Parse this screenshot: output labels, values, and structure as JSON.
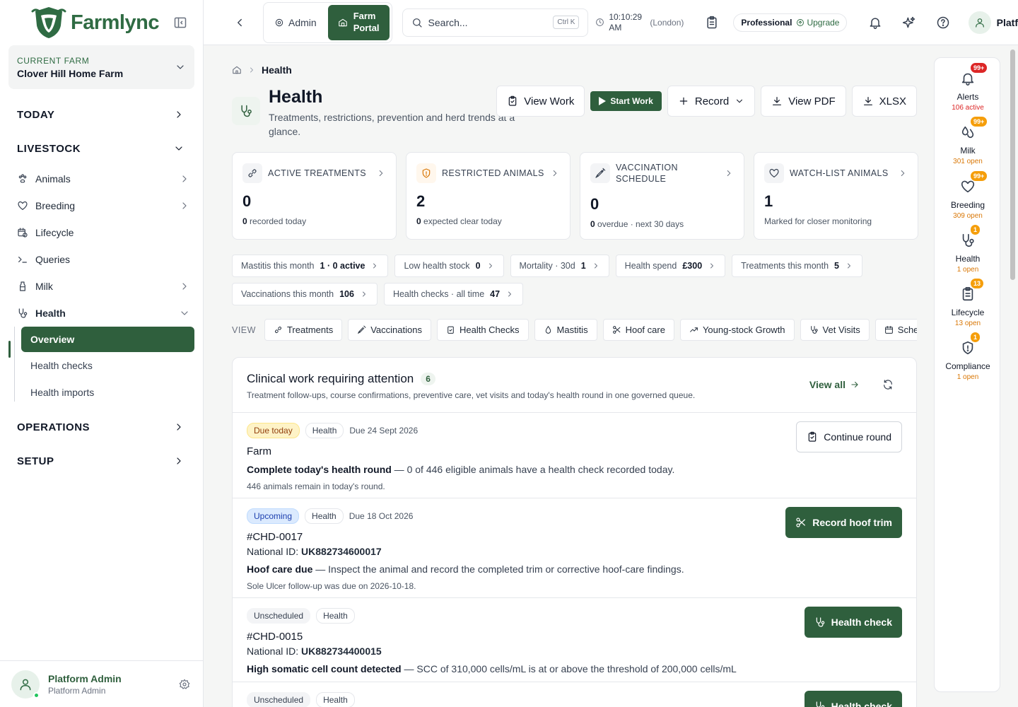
{
  "brand": {
    "name": "Farmlync"
  },
  "farm": {
    "label": "CURRENT FARM",
    "name": "Clover Hill Home Farm"
  },
  "nav": {
    "today": "TODAY",
    "livestock": "LIVESTOCK",
    "items": [
      "Animals",
      "Breeding",
      "Lifecycle",
      "Queries",
      "Milk",
      "Health"
    ],
    "health_sub": [
      "Overview",
      "Health checks",
      "Health imports"
    ],
    "operations": "OPERATIONS",
    "setup": "SETUP"
  },
  "user": {
    "name": "Platform Admin",
    "role": "Platform Admin"
  },
  "topbar": {
    "admin": "Admin",
    "portal_line1": "Farm",
    "portal_line2": "Portal",
    "search_placeholder": "Search...",
    "shortcut": "Ctrl K",
    "time_line1": "10:10:29",
    "time_line2": "AM",
    "zone": "(London)",
    "plan": "Professional",
    "upgrade": "Upgrade",
    "user_short": "Platf"
  },
  "breadcrumb": {
    "current": "Health"
  },
  "page": {
    "title": "Health",
    "subtitle": "Treatments, restrictions, prevention and herd trends at a glance."
  },
  "actions": {
    "view_work": "View Work",
    "start_work": "Start Work",
    "record": "Record",
    "view_pdf": "View PDF",
    "xlsx": "XLSX"
  },
  "kpis": [
    {
      "label": "ACTIVE TREATMENTS",
      "value": "0",
      "note_b": "0",
      "note": " recorded today"
    },
    {
      "label": "RESTRICTED ANIMALS",
      "value": "2",
      "note_b": "0",
      "note": " expected clear today"
    },
    {
      "label": "VACCINATION SCHEDULE",
      "value": "0",
      "note_b": "0",
      "note": " overdue · next 30 days"
    },
    {
      "label": "WATCH-LIST ANIMALS",
      "value": "1",
      "note_b": "",
      "note": "Marked for closer monitoring"
    }
  ],
  "chips": [
    {
      "label": "Mastitis this month",
      "value": "1 · 0 active"
    },
    {
      "label": "Low health stock",
      "value": "0"
    },
    {
      "label": "Mortality · 30d",
      "value": "1"
    },
    {
      "label": "Health spend",
      "value": "£300"
    },
    {
      "label": "Treatments this month",
      "value": "5"
    },
    {
      "label": "Vaccinations this month",
      "value": "106"
    },
    {
      "label": "Health checks · all time",
      "value": "47"
    }
  ],
  "view": {
    "label": "VIEW",
    "tabs": [
      "Treatments",
      "Vaccinations",
      "Health Checks",
      "Mastitis",
      "Hoof care",
      "Young-stock Growth",
      "Vet Visits",
      "Schedule vet"
    ]
  },
  "panel": {
    "title": "Clinical work requiring attention",
    "count": "6",
    "subtitle": "Treatment follow-ups, course confirmations, preventive care, vet visits and today's health round in one governed queue.",
    "view_all": "View all",
    "rows": [
      {
        "status": "Due today",
        "category": "Health",
        "due": "Due 24 Sept 2026",
        "title": "Farm",
        "desc_b": "Complete today's health round",
        "desc": " — 0 of 446 eligible animals have a health check recorded today.",
        "note": "446 animals remain in today's round.",
        "action": "Continue round"
      },
      {
        "status": "Upcoming",
        "category": "Health",
        "due": "Due 18 Oct 2026",
        "title": "#CHD-0017",
        "nid_label": "National ID: ",
        "nid": "UK882734600017",
        "desc_b": "Hoof care due",
        "desc": " — Inspect the animal and record the completed trim or corrective hoof-care findings.",
        "note": "Sole Ulcer follow-up was due on 2026-10-18.",
        "action": "Record hoof trim"
      },
      {
        "status": "Unscheduled",
        "category": "Health",
        "title": "#CHD-0015",
        "nid_label": "National ID: ",
        "nid": "UK882734400015",
        "desc_b": "High somatic cell count detected",
        "desc": " — SCC of 310,000 cells/mL is at or above the threshold of 200,000 cells/mL",
        "action": "Health check"
      },
      {
        "status": "Unscheduled",
        "category": "Health",
        "action": "Health check"
      }
    ]
  },
  "rail": [
    {
      "label": "Alerts",
      "badge": "99+",
      "sub": "106 active"
    },
    {
      "label": "Milk",
      "badge": "99+",
      "sub": "301 open"
    },
    {
      "label": "Breeding",
      "badge": "99+",
      "sub": "309 open"
    },
    {
      "label": "Health",
      "badge": "1",
      "sub": "1 open"
    },
    {
      "label": "Lifecycle",
      "badge": "13",
      "sub": "13 open"
    },
    {
      "label": "Compliance",
      "badge": "1",
      "sub": "1 open"
    }
  ],
  "colors": {
    "brand": "#2f5f3d",
    "accent": "#2f6b43",
    "warning": "#f59e0b",
    "danger": "#dc2626"
  }
}
